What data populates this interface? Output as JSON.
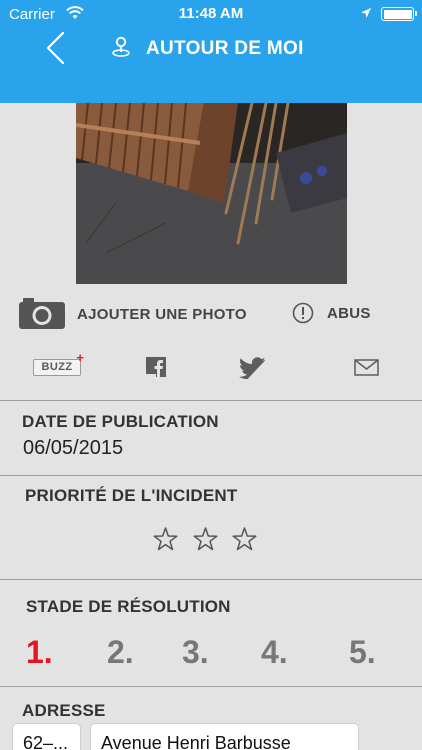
{
  "status_bar": {
    "carrier": "Carrier",
    "time": "11:48 AM",
    "icons": [
      "wifi-icon",
      "location-arrow-icon",
      "battery-icon"
    ]
  },
  "nav": {
    "title": "AUTOUR DE MOI",
    "back_icon": "chevron-left-icon",
    "title_icon": "map-pin-icon"
  },
  "actions": {
    "add_photo": "AJOUTER UNE PHOTO",
    "abuse": "ABUS",
    "camera_icon": "camera-icon",
    "abuse_icon": "exclamation-circle-icon"
  },
  "share": {
    "buzz_label": "BUZZ",
    "buzz_plus": "+",
    "icons": [
      "buzz-icon",
      "facebook-icon",
      "twitter-icon",
      "mail-icon"
    ]
  },
  "publication": {
    "label": "DATE DE PUBLICATION",
    "date": "06/05/2015"
  },
  "priority": {
    "label": "PRIORITÉ DE L'INCIDENT",
    "rating": 0,
    "max": 3
  },
  "resolution": {
    "label": "STADE DE RÉSOLUTION",
    "stages": [
      "1.",
      "2.",
      "3.",
      "4.",
      "5."
    ],
    "active_index": 0
  },
  "address": {
    "label": "ADRESSE",
    "number": "62–...",
    "street": "Avenue Henri Barbusse"
  },
  "colors": {
    "header": "#29a3ec",
    "background": "#e3e3e3",
    "active_stage": "#e3151f",
    "inactive_stage": "#777777"
  }
}
